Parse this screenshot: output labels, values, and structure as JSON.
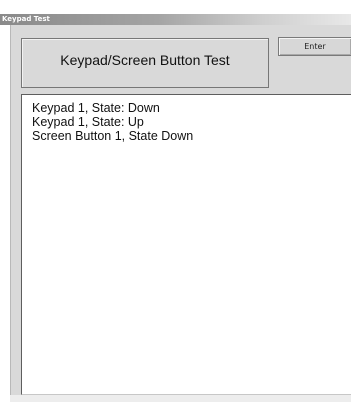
{
  "window": {
    "title": "Keypad Test"
  },
  "header": {
    "title": "Keypad/Screen Button Test",
    "enter_label": "Enter"
  },
  "log": {
    "lines": [
      "Keypad 1, State: Down",
      "Keypad 1, State: Up",
      "Screen Button 1, State Down"
    ]
  }
}
